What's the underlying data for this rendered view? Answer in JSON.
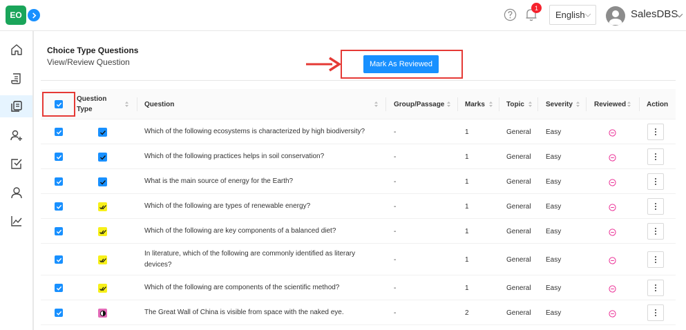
{
  "header": {
    "logo_text": "EO",
    "notification_count": "1",
    "language": "English",
    "user_name": "SalesDBS"
  },
  "sidebar": {
    "items": [
      {
        "icon": "home-icon"
      },
      {
        "icon": "scroll-icon"
      },
      {
        "icon": "question-bank-icon",
        "active": true
      },
      {
        "icon": "add-user-icon"
      },
      {
        "icon": "checkbox-icon"
      },
      {
        "icon": "user-icon"
      },
      {
        "icon": "chart-icon"
      }
    ]
  },
  "page": {
    "title": "Choice Type Questions",
    "subtitle": "View/Review Question",
    "mark_reviewed_label": "Mark As Reviewed"
  },
  "table": {
    "columns": {
      "question_type": "Question Type",
      "question": "Question",
      "group": "Group/Passage",
      "marks": "Marks",
      "topic": "Topic",
      "severity": "Severity",
      "reviewed": "Reviewed",
      "action": "Action"
    },
    "rows": [
      {
        "type": "single",
        "question": "Which of the following ecosystems is characterized by high biodiversity?",
        "group": "-",
        "marks": "1",
        "topic": "General",
        "severity": "Easy"
      },
      {
        "type": "single",
        "question": "Which of the following practices helps in soil conservation?",
        "group": "-",
        "marks": "1",
        "topic": "General",
        "severity": "Easy"
      },
      {
        "type": "single",
        "question": "What is the main source of energy for the Earth?",
        "group": "-",
        "marks": "1",
        "topic": "General",
        "severity": "Easy"
      },
      {
        "type": "multi",
        "question": "Which of the following are types of renewable energy?",
        "group": "-",
        "marks": "1",
        "topic": "General",
        "severity": "Easy"
      },
      {
        "type": "multi",
        "question": "Which of the following are key components of a balanced diet?",
        "group": "-",
        "marks": "1",
        "topic": "General",
        "severity": "Easy"
      },
      {
        "type": "multi",
        "question": "In literature, which of the following are commonly identified as literary devices?",
        "group": "-",
        "marks": "1",
        "topic": "General",
        "severity": "Easy"
      },
      {
        "type": "multi",
        "question": "Which of the following are components of the scientific method?",
        "group": "-",
        "marks": "1",
        "topic": "General",
        "severity": "Easy"
      },
      {
        "type": "tf",
        "question": "The Great Wall of China is visible from space with the naked eye.",
        "group": "-",
        "marks": "2",
        "topic": "General",
        "severity": "Easy"
      }
    ]
  },
  "colors": {
    "primary": "#1890ff",
    "logo": "#1aa55a",
    "highlight": "#e53935",
    "reviewed_icon": "#eb2f96"
  }
}
